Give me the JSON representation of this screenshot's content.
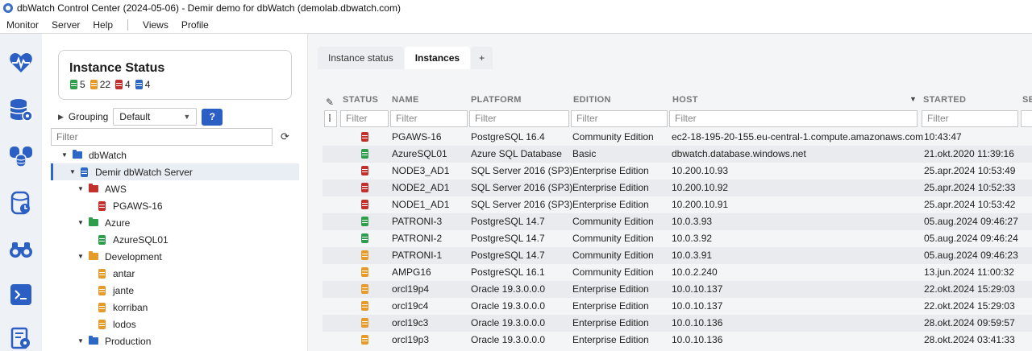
{
  "window": {
    "title": "dbWatch Control Center  (2024-05-06) - Demir demo for dbWatch (demolab.dbwatch.com)"
  },
  "menu": {
    "items_left": [
      "Monitor",
      "Server",
      "Help"
    ],
    "items_right": [
      "Views",
      "Profile"
    ]
  },
  "leftbar": {
    "icons": [
      "heartbeat-icon",
      "database-settings-icon",
      "database-stack-icon",
      "database-report-icon",
      "binoculars-icon",
      "terminal-icon",
      "report-settings-icon"
    ]
  },
  "status": {
    "title": "Instance Status",
    "green": "5",
    "orange": "22",
    "red": "4",
    "blue": "4"
  },
  "grouping": {
    "label": "Grouping",
    "value": "Default",
    "help": "?"
  },
  "tree_filter": {
    "placeholder": "Filter"
  },
  "tree": {
    "root": "dbWatch",
    "server": "Demir dbWatch Server",
    "groups": [
      {
        "name": "AWS",
        "color": "#c2302e",
        "items": [
          {
            "name": "PGAWS-16",
            "status": "red"
          }
        ]
      },
      {
        "name": "Azure",
        "color": "#2e9e4c",
        "items": [
          {
            "name": "AzureSQL01",
            "status": "green"
          }
        ]
      },
      {
        "name": "Development",
        "color": "#e69a2a",
        "items": [
          {
            "name": "antar",
            "status": "orange"
          },
          {
            "name": "jante",
            "status": "orange"
          },
          {
            "name": "korriban",
            "status": "orange"
          },
          {
            "name": "lodos",
            "status": "orange"
          }
        ]
      },
      {
        "name": "Production",
        "color": "#2c68c4",
        "items": []
      }
    ]
  },
  "tabs": [
    {
      "label": "Instance status",
      "active": false
    },
    {
      "label": "Instances",
      "active": true
    },
    {
      "label": "+",
      "active": false
    }
  ],
  "table": {
    "columns": [
      "STATUS",
      "NAME",
      "PLATFORM",
      "EDITION",
      "HOST",
      "STARTED",
      "SE"
    ],
    "filter_placeholder": "Filter",
    "rows": [
      {
        "status": "red",
        "name": "PGAWS-16",
        "platform": "PostgreSQL 16.4",
        "edition": "Community Edition",
        "host": "ec2-18-195-20-155.eu-central-1.compute.amazonaws.com",
        "started": "10:43:47"
      },
      {
        "status": "green",
        "name": "AzureSQL01",
        "platform": "Azure SQL Database",
        "edition": "Basic",
        "host": "dbwatch.database.windows.net",
        "started": "21.okt.2020 11:39:16"
      },
      {
        "status": "red",
        "name": "NODE3_AD1",
        "platform": "SQL Server 2016 (SP3)",
        "edition": "Enterprise Edition",
        "host": "10.200.10.93",
        "started": "25.apr.2024 10:53:49"
      },
      {
        "status": "red",
        "name": "NODE2_AD1",
        "platform": "SQL Server 2016 (SP3)",
        "edition": "Enterprise Edition",
        "host": "10.200.10.92",
        "started": "25.apr.2024 10:52:33"
      },
      {
        "status": "red",
        "name": "NODE1_AD1",
        "platform": "SQL Server 2016 (SP3)",
        "edition": "Enterprise Edition",
        "host": "10.200.10.91",
        "started": "25.apr.2024 10:53:42"
      },
      {
        "status": "green",
        "name": "PATRONI-3",
        "platform": "PostgreSQL 14.7",
        "edition": "Community Edition",
        "host": "10.0.3.93",
        "started": "05.aug.2024 09:46:27"
      },
      {
        "status": "green",
        "name": "PATRONI-2",
        "platform": "PostgreSQL 14.7",
        "edition": "Community Edition",
        "host": "10.0.3.92",
        "started": "05.aug.2024 09:46:24"
      },
      {
        "status": "orange",
        "name": "PATRONI-1",
        "platform": "PostgreSQL 14.7",
        "edition": "Community Edition",
        "host": "10.0.3.91",
        "started": "05.aug.2024 09:46:23"
      },
      {
        "status": "orange",
        "name": "AMPG16",
        "platform": "PostgreSQL 16.1",
        "edition": "Community Edition",
        "host": "10.0.2.240",
        "started": "13.jun.2024 11:00:32"
      },
      {
        "status": "orange",
        "name": "orcl19p4",
        "platform": "Oracle 19.3.0.0.0",
        "edition": "Enterprise Edition",
        "host": "10.0.10.137",
        "started": "22.okt.2024 15:29:03"
      },
      {
        "status": "orange",
        "name": "orcl19c4",
        "platform": "Oracle 19.3.0.0.0",
        "edition": "Enterprise Edition",
        "host": "10.0.10.137",
        "started": "22.okt.2024 15:29:03"
      },
      {
        "status": "orange",
        "name": "orcl19c3",
        "platform": "Oracle 19.3.0.0.0",
        "edition": "Enterprise Edition",
        "host": "10.0.10.136",
        "started": "28.okt.2024 09:59:57"
      },
      {
        "status": "orange",
        "name": "orcl19p3",
        "platform": "Oracle 19.3.0.0.0",
        "edition": "Enterprise Edition",
        "host": "10.0.10.136",
        "started": "28.okt.2024 03:41:33"
      }
    ]
  }
}
